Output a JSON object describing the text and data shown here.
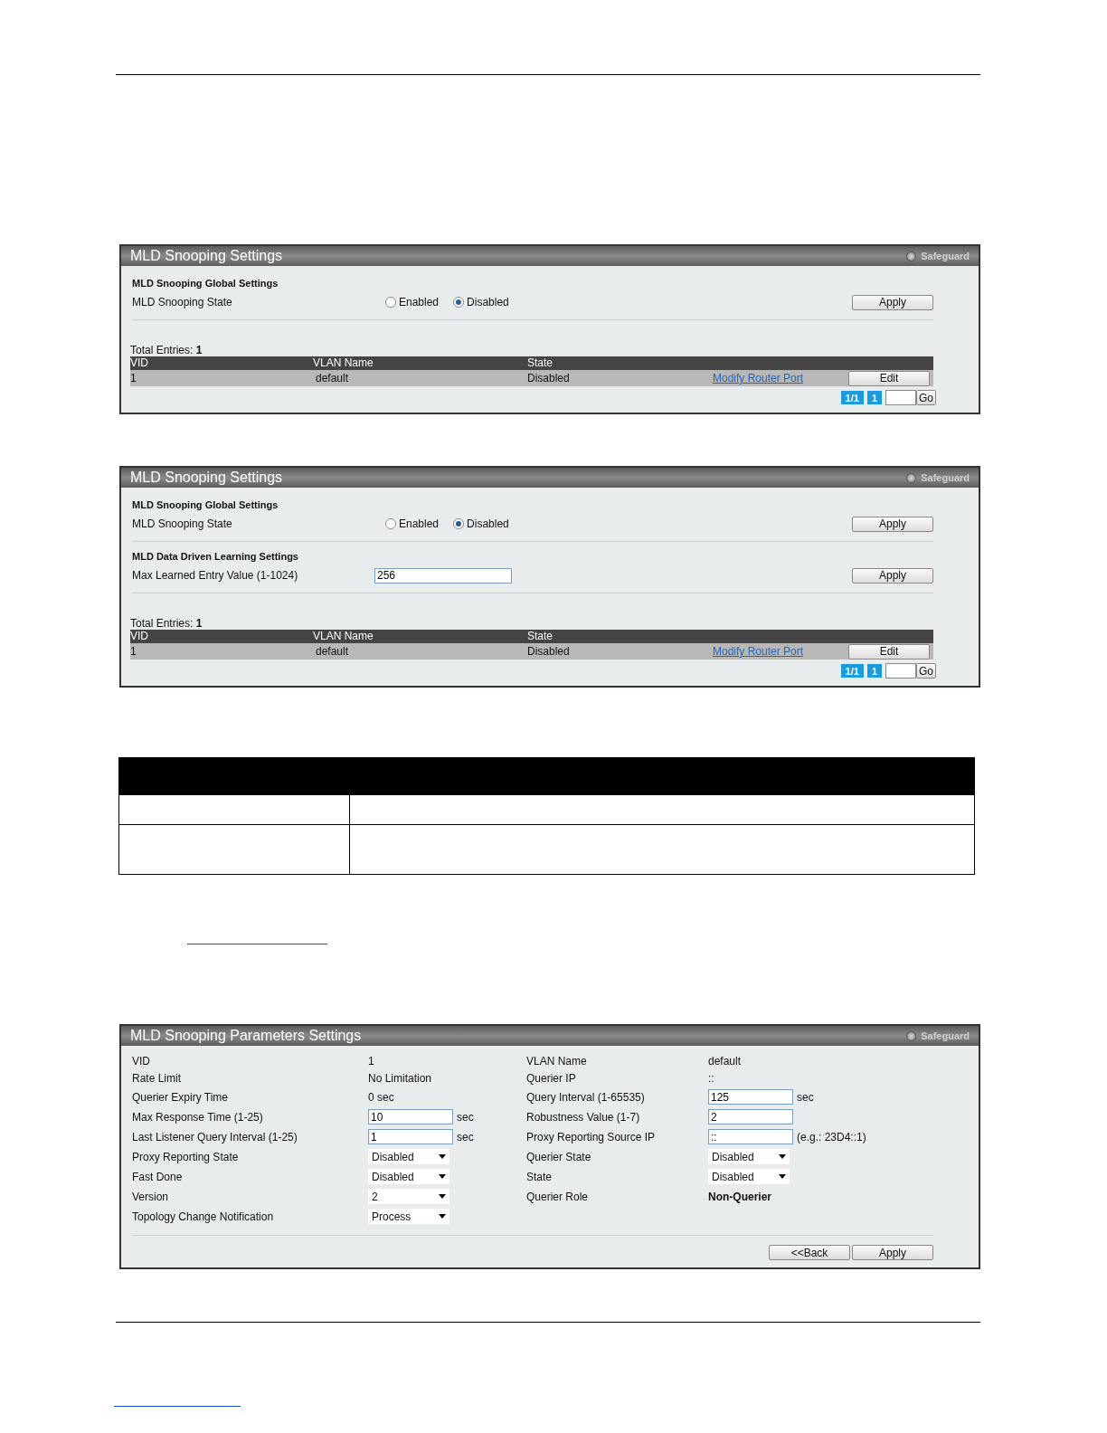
{
  "panels": [
    {
      "title": "MLD Snooping Settings",
      "safeguard": "Safeguard",
      "sections": [
        {
          "heading": "MLD Snooping Global Settings",
          "rows": [
            {
              "kind": "radio",
              "label": "MLD Snooping State",
              "options": [
                {
                  "label": "Enabled",
                  "selected": false
                },
                {
                  "label": "Disabled",
                  "selected": true
                }
              ],
              "button": "Apply"
            }
          ]
        }
      ],
      "table": {
        "total_label": "Total Entries:",
        "total": "1",
        "columns": [
          "VID",
          "VLAN Name",
          "State"
        ],
        "rows": [
          {
            "cells": [
              "1",
              "default",
              "Disabled"
            ],
            "link": "Modify Router Port",
            "button": "Edit"
          }
        ]
      },
      "pager": {
        "pages": "1/1",
        "page": "1",
        "go": "Go"
      }
    },
    {
      "title": "MLD Snooping Settings",
      "safeguard": "Safeguard",
      "sections": [
        {
          "heading": "MLD Snooping Global Settings",
          "rows": [
            {
              "kind": "radio",
              "label": "MLD Snooping State",
              "options": [
                {
                  "label": "Enabled",
                  "selected": false
                },
                {
                  "label": "Disabled",
                  "selected": true
                }
              ],
              "button": "Apply"
            }
          ]
        },
        {
          "heading": "MLD Data Driven Learning Settings",
          "rows": [
            {
              "kind": "input",
              "label": "Max Learned Entry Value (1-1024)",
              "value": "256",
              "button": "Apply"
            }
          ]
        }
      ],
      "table": {
        "total_label": "Total Entries:",
        "total": "1",
        "columns": [
          "VID",
          "VLAN Name",
          "State"
        ],
        "rows": [
          {
            "cells": [
              "1",
              "default",
              "Disabled"
            ],
            "link": "Modify Router Port",
            "button": "Edit"
          }
        ]
      },
      "pager": {
        "pages": "1/1",
        "page": "1",
        "go": "Go"
      }
    }
  ],
  "params_panel": {
    "title": "MLD Snooping Parameters Settings",
    "safeguard": "Safeguard",
    "rows": [
      {
        "left": {
          "label": "VID",
          "kind": "text",
          "value": "1"
        },
        "right": {
          "label": "VLAN Name",
          "kind": "text",
          "value": "default"
        }
      },
      {
        "left": {
          "label": "Rate Limit",
          "kind": "text",
          "value": "No Limitation"
        },
        "right": {
          "label": "Querier IP",
          "kind": "text",
          "value": "::"
        }
      },
      {
        "left": {
          "label": "Querier Expiry Time",
          "kind": "text",
          "value": "0 sec"
        },
        "right": {
          "label": "Query Interval (1-65535)",
          "kind": "input",
          "value": "125",
          "unit": "sec"
        }
      },
      {
        "left": {
          "label": "Max Response Time (1-25)",
          "kind": "input",
          "value": "10",
          "unit": "sec"
        },
        "right": {
          "label": "Robustness Value (1-7)",
          "kind": "input",
          "value": "2"
        }
      },
      {
        "left": {
          "label": "Last Listener Query Interval (1-25)",
          "kind": "input",
          "value": "1",
          "unit": "sec"
        },
        "right": {
          "label": "Proxy Reporting Source IP",
          "kind": "input",
          "value": "::",
          "unit": "(e.g.: 23D4::1)"
        }
      },
      {
        "left": {
          "label": "Proxy Reporting State",
          "kind": "select",
          "value": "Disabled"
        },
        "right": {
          "label": "Querier State",
          "kind": "select",
          "value": "Disabled"
        }
      },
      {
        "left": {
          "label": "Fast Done",
          "kind": "select",
          "value": "Disabled"
        },
        "right": {
          "label": "State",
          "kind": "select",
          "value": "Disabled"
        }
      },
      {
        "left": {
          "label": "Version",
          "kind": "select",
          "value": "2"
        },
        "right": {
          "label": "Querier Role",
          "kind": "strong",
          "value": "Non-Querier"
        }
      },
      {
        "left": {
          "label": "Topology Change Notification",
          "kind": "select",
          "value": "Process"
        }
      }
    ],
    "buttons": [
      "<<Back",
      "Apply"
    ]
  }
}
